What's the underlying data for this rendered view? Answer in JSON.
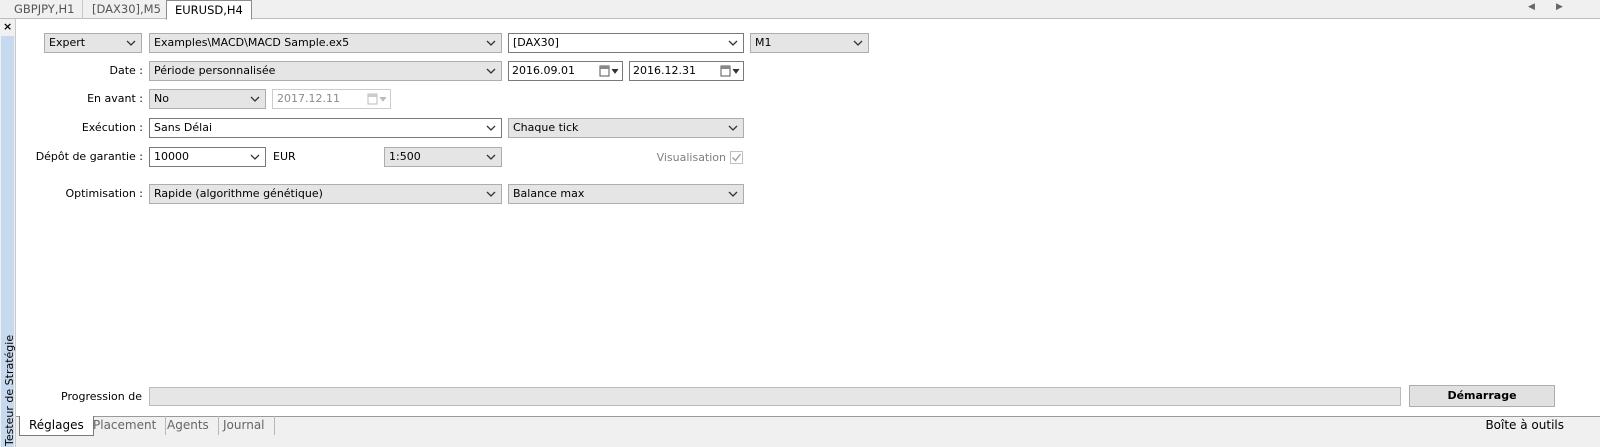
{
  "chart_tabs": [
    {
      "label": "GBPJPY,H1",
      "active": false
    },
    {
      "label": "[DAX30],M5",
      "active": false
    },
    {
      "label": "EURUSD,H4",
      "active": true
    }
  ],
  "panel": {
    "title": "Testeur de Stratégie",
    "close_label": "×"
  },
  "form": {
    "program_type": "Expert",
    "expert_path": "Examples\\MACD\\MACD Sample.ex5",
    "symbol": "[DAX30]",
    "timeframe": "M1",
    "date": {
      "label": "Date :",
      "period": "Période personnalisée",
      "from": "2016.09.01",
      "to": "2016.12.31"
    },
    "forward": {
      "label": "En avant :",
      "value": "No",
      "date": "2017.12.11"
    },
    "execution": {
      "label": "Exécution :",
      "delay": "Sans Délai",
      "model": "Chaque tick"
    },
    "deposit": {
      "label": "Dépôt de garantie :",
      "amount": "10000",
      "currency": "EUR",
      "leverage": "1:500"
    },
    "visualisation": {
      "label": "Visualisation",
      "checked": true
    },
    "optimisation": {
      "label": "Optimisation :",
      "method": "Rapide (algorithme génétique)",
      "criterion": "Balance max"
    }
  },
  "progress": {
    "label": "Progression de",
    "value": 0
  },
  "start_button": "Démarrage",
  "bottom_tabs": [
    {
      "label": "Réglages",
      "active": true
    },
    {
      "label": "Placement",
      "active": false
    },
    {
      "label": "Agents",
      "active": false
    },
    {
      "label": "Journal",
      "active": false
    }
  ],
  "toolbox_label": "Boîte à outils"
}
